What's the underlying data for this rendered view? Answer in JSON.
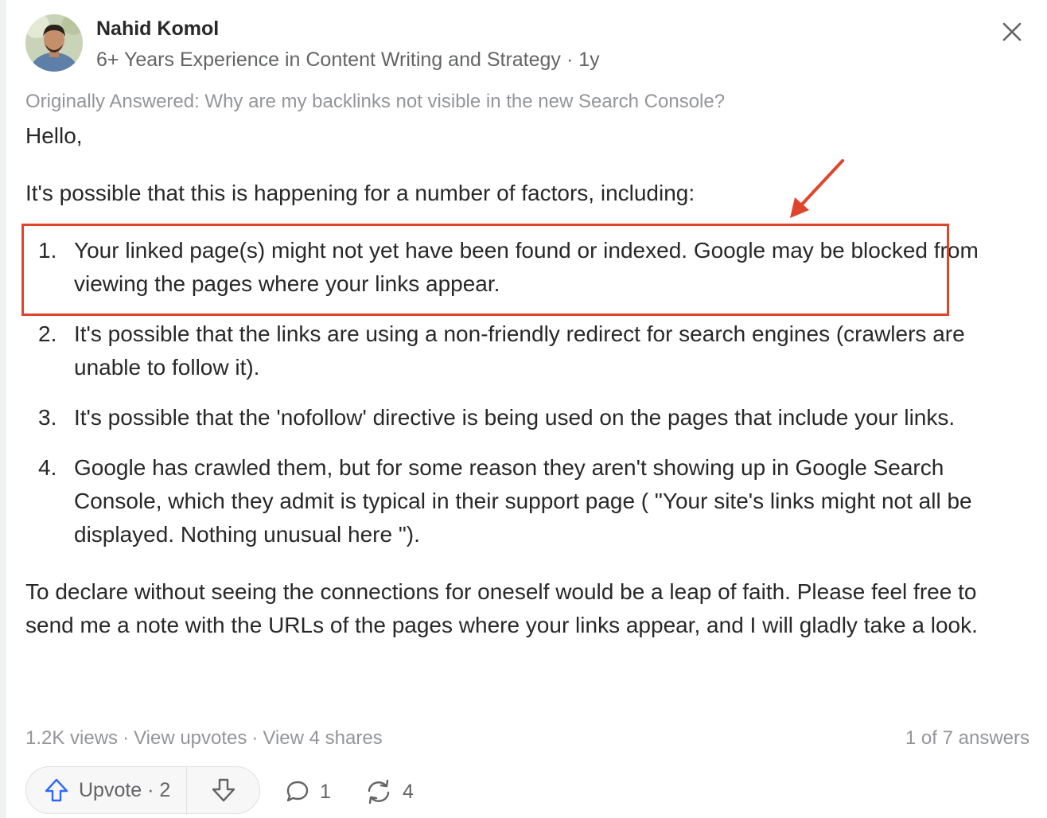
{
  "author": {
    "name": "Nahid Komol",
    "credential": "6+ Years Experience in Content Writing and Strategy",
    "separator": "·",
    "time": "1y"
  },
  "original_question": "Originally Answered: Why are my backlinks not visible in the new Search Console?",
  "answer": {
    "greeting": "Hello,",
    "intro": "It's possible that this is happening for a number of factors, including:",
    "items": [
      {
        "number": "1.",
        "text": "Your linked page(s) might not yet have been found or indexed. Google may be blocked from viewing the pages where your links appear."
      },
      {
        "number": "2.",
        "text": "It's possible that the links are using a non-friendly redirect for search engines (crawlers are unable to follow it)."
      },
      {
        "number": "3.",
        "text": "It's possible that the 'nofollow' directive is being used on the pages that include your links."
      },
      {
        "number": "4.",
        "text": "Google has crawled them, but for some reason they aren't showing up in Google Search Console, which they admit is typical in their support page ( \"Your site's links might not all be displayed. Nothing unusual here \")."
      }
    ],
    "closing": "To declare without seeing the connections for oneself would be a leap of faith. Please feel free to send me a note with the URLs of the pages where your links appear, and I will gladly take a look."
  },
  "stats": {
    "views": "1.2K views",
    "separator": "·",
    "view_upvotes": "View upvotes",
    "view_shares": "View 4 shares",
    "answer_position": "1 of 7 answers"
  },
  "actions": {
    "upvote_label": "Upvote · 2",
    "comment_count": "1",
    "share_count": "4"
  },
  "colors": {
    "highlight": "#e0452b",
    "upvote_icon": "#2e69ff",
    "muted_text": "#939598",
    "secondary_text": "#636466"
  },
  "icons": [
    "close-icon",
    "upvote-arrow-icon",
    "downvote-arrow-icon",
    "comment-bubble-icon",
    "share-cycle-icon",
    "annotation-arrow"
  ]
}
